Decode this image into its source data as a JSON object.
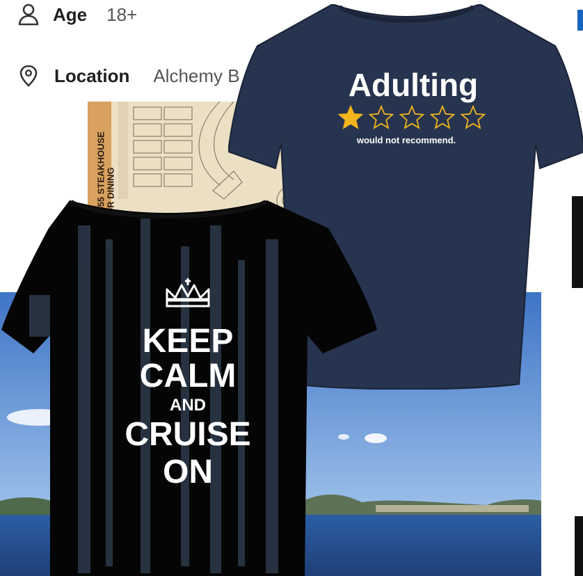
{
  "info": {
    "age_label": "Age",
    "age_value": "18+",
    "location_label": "Location",
    "location_value": "Alchemy B"
  },
  "deck_map": {
    "venue_lines": [
      "EIT 555 STEAKHOUSE",
      "DOOR DINING"
    ]
  },
  "navy_shirt": {
    "title": "Adulting",
    "rating_filled": 1,
    "rating_total": 5,
    "caption": "would not recommend."
  },
  "black_shirt": {
    "line1": "KEEP",
    "line2": "CALM",
    "line3": "AND",
    "line4": "CRUISE",
    "line5": "ON"
  },
  "colors": {
    "accent_blue": "#1565c0",
    "navy_shirt": "#26344e",
    "star_gold": "#f2b51d",
    "sky": "#5b8fd6",
    "sea": "#2f4f8a"
  }
}
